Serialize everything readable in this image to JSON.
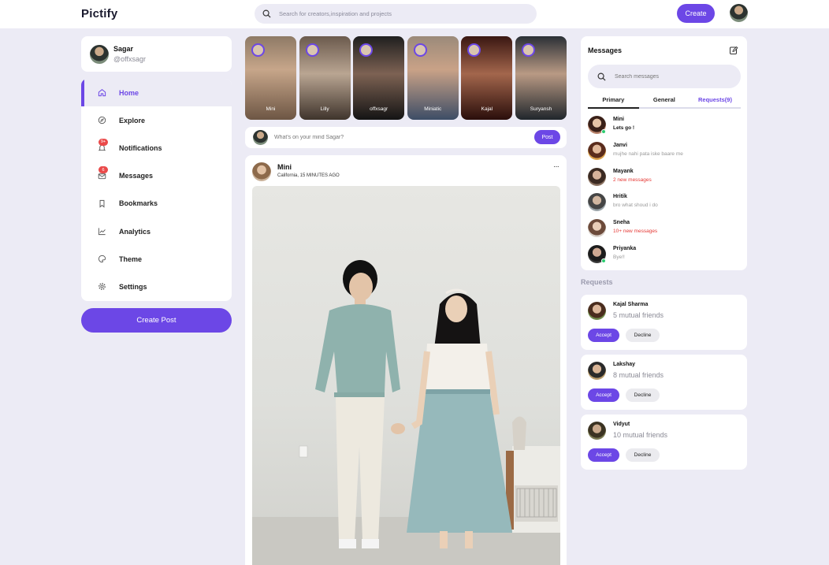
{
  "app": {
    "logo": "Pictify"
  },
  "topbar": {
    "search_placeholder": "Search for creators,inspiration and projects",
    "create_label": "Create"
  },
  "profile": {
    "name": "Sagar",
    "handle": "@offxsagr"
  },
  "nav": {
    "items": [
      {
        "label": "Home",
        "icon": "home-icon",
        "active": true
      },
      {
        "label": "Explore",
        "icon": "compass-icon"
      },
      {
        "label": "Notifications",
        "icon": "bell-icon",
        "badge": "9+"
      },
      {
        "label": "Messages",
        "icon": "mail-icon",
        "badge": "6"
      },
      {
        "label": "Bookmarks",
        "icon": "bookmark-icon"
      },
      {
        "label": "Analytics",
        "icon": "chart-icon"
      },
      {
        "label": "Theme",
        "icon": "palette-icon"
      },
      {
        "label": "Settings",
        "icon": "gear-icon"
      }
    ],
    "create_post_label": "Create Post"
  },
  "stories": [
    {
      "name": "Mini"
    },
    {
      "name": "Lilly"
    },
    {
      "name": "offxsagr"
    },
    {
      "name": "Miniatic"
    },
    {
      "name": "Kajal"
    },
    {
      "name": "Suryansh"
    }
  ],
  "composer": {
    "placeholder": "What's on your mind Sagar?",
    "post_label": "Post"
  },
  "feed": {
    "post": {
      "author": "Mini",
      "meta": "California, 15 MINUTES AGO",
      "more": "···"
    }
  },
  "messages": {
    "title": "Messages",
    "search_placeholder": "Search messages",
    "tabs": [
      "Primary",
      "General",
      "Requests(9)"
    ],
    "items": [
      {
        "name": "Mini",
        "text": "Lets go !",
        "style": "bold",
        "online": true
      },
      {
        "name": "Janvi",
        "text": "mujhe nahi pata iske baare me",
        "style": "muted",
        "online": false
      },
      {
        "name": "Mayank",
        "text": "2 new messages",
        "style": "red",
        "online": false
      },
      {
        "name": "Hritik",
        "text": "bro what shoud i do",
        "style": "muted",
        "online": false
      },
      {
        "name": "Sneha",
        "text": "10+ new messages",
        "style": "red",
        "online": false
      },
      {
        "name": "Priyanka",
        "text": "Bye!!",
        "style": "muted",
        "online": true
      }
    ]
  },
  "requests": {
    "title": "Requests",
    "accept_label": "Accept",
    "decline_label": "Decline",
    "items": [
      {
        "name": "Kajal Sharma",
        "mutual": "5 mutual friends"
      },
      {
        "name": "Lakshay",
        "mutual": "8 mutual friends"
      },
      {
        "name": "Vidyut",
        "mutual": "10 mutual friends"
      }
    ]
  },
  "colors": {
    "accent": "#6c47e6",
    "background": "#ecebf5",
    "danger": "#e53935",
    "online": "#2ecc71"
  }
}
